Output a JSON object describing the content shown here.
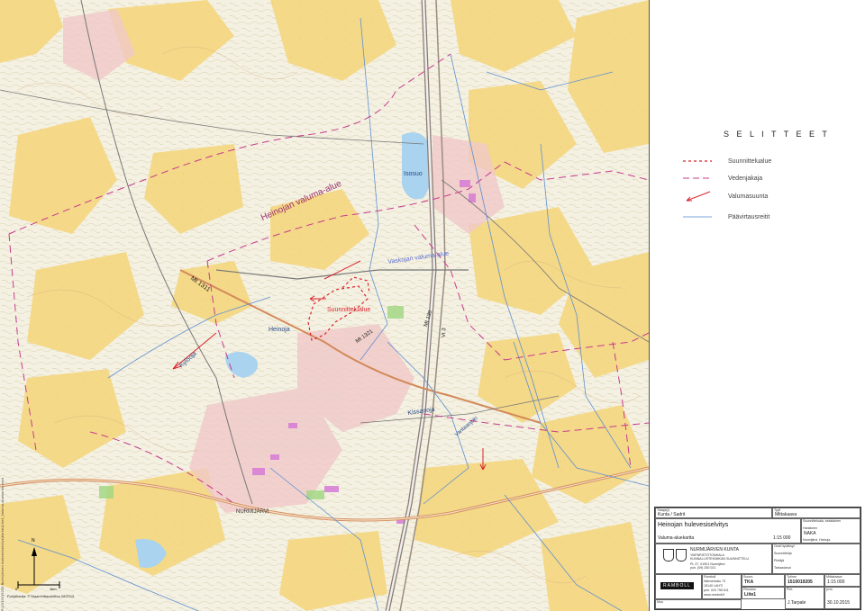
{
  "map": {
    "place_labels": {
      "isosuo": "Isosuo",
      "heinoja": "Heinoja",
      "kissanoja": "Kissanoja",
      "vantaanjoki": "Vantaanjoki",
      "nurmijarvi": "NURMIJÄRVI",
      "kyloja": "Kylöoja"
    },
    "area_labels": {
      "heinojan_valuma_alue": "Heinojan valuma-alue",
      "vaskojan_valuma_alue": "Vaskojan valuma-alue",
      "suunnittelualue": "Suunnittelualue"
    },
    "road_labels": {
      "mt1311": "Mt 1311",
      "mt1321": "Mt 1321",
      "mt130": "Mt 130",
      "vt3": "Vt 3"
    },
    "scale_zero": "0",
    "scale_end": "1km",
    "north_label": "N",
    "credit": "Pohjakartta: © Maanmittauslaitos 08/2015",
    "side_path": "P:\\1510019205 Nurmijärven hulevesiselvitys\\Kartat\\Liite1_Valuma-aluekartta.mxd"
  },
  "legend": {
    "title": "S E L I T T E E T",
    "items": [
      {
        "label": "Suunnittelualue",
        "color": "#d9232d",
        "style": "dashed-short"
      },
      {
        "label": "Vedenjakaja",
        "color": "#c73a8e",
        "style": "dashed-long"
      },
      {
        "label": "Valumasuunta",
        "color": "#d9232d",
        "style": "arrow"
      },
      {
        "label": "Päävirtausreitit",
        "color": "#7aa6dc",
        "style": "solid"
      }
    ]
  },
  "titleblock": {
    "client_label": "Tilaaja(t)",
    "client": "Kunta / Sadrit",
    "status_label": "Tyyli",
    "status": "Mittakaava",
    "title_main": "Heinojan hulevesiselvitys",
    "subtitle": "Valuma-aluekartta",
    "scale": "1:15 000",
    "approved_label": "Suunnitteluala, sekalainen",
    "municipality_label": "Hankkeen",
    "municipality": "NAKA",
    "project_label": "Nurmijärvi, Heinoja",
    "org_line1": "NURMIJÄRVEN KUNTA",
    "org_line2": "YMPÄRISTÖTOIMIALA",
    "org_line3": "KUNNALLISTEKNIIKAN SUUNNITTELU",
    "org_addr1": "PL 37, 01901 Nurmijärvi",
    "org_addr2": "puh. (09) 250 021",
    "approval_label": "Ovat hyväksyt",
    "designer_label": "Suunnittelija",
    "drawer_label": "Piirtäjä",
    "checker_label": "Tarkastanut",
    "ramboll": "RAMBOLL",
    "company_addr1": "Ramboll",
    "company_addr2": "Niemenkatu 73",
    "company_addr3": "15140 LAHTI",
    "company_addr4": "puh. 020 755 611",
    "company_addr5": "www.ramboll.fi",
    "tunnus_label": "Suunn.",
    "tunnus": "TKA",
    "job_label": "Työnro",
    "job": "1510019205",
    "scale_label": "Mittakaava",
    "scale2": "1:15 000",
    "sheet_label": "Piirustus",
    "sheet": "Liite1",
    "drawn_label": "Piirt.",
    "drawn": "J.Tarpale",
    "date_label": "pvm",
    "date": "30.10.2015",
    "muu_label": "Muu"
  }
}
